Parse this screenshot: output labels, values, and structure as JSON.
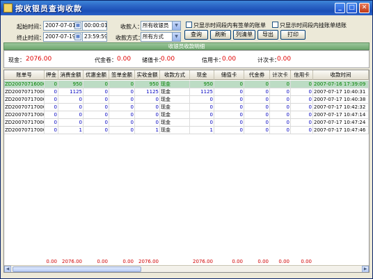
{
  "window": {
    "title": "按收银员查询收款"
  },
  "filters": {
    "start_label": "起始时间：",
    "start_date": "2007-07-01",
    "start_time": "00:00:01",
    "end_label": "终止时间：",
    "end_date": "2007-07-19",
    "end_time": "23:59:59",
    "cashier_label": "收款人：",
    "cashier_value": "所有收银员",
    "method_label": "收款方式：",
    "method_value": "所有方式",
    "chk1_label": "只显示时间段内有签单的账单",
    "chk2_label": "只显示时间段内挂账单结账"
  },
  "buttons": {
    "query": "查询",
    "refresh": "刷新",
    "list": "列清单",
    "export": "导出",
    "print": "打印"
  },
  "section_title": "收银员收款明细",
  "summary": {
    "cash_label": "现金：",
    "cash_value": "2076.00",
    "voucher_label": "代金卷：",
    "voucher_value": "0.00",
    "stored_label": "储值卡：",
    "stored_value": "0.00",
    "credit_label": "信用卡：",
    "credit_value": "0.00",
    "count_label": "计次卡：",
    "count_value": "0.00"
  },
  "table": {
    "columns": [
      "账单号",
      "押金",
      "消费金额",
      "优惠金额",
      "签单金额",
      "实收金额",
      "收款方式",
      "现金",
      "储值卡",
      "代金券",
      "计次卡",
      "信用卡",
      "收款时间"
    ],
    "rows": [
      [
        "ZD200707160001",
        "0",
        "950",
        "0",
        "0",
        "950",
        "现金",
        "950",
        "0",
        "0",
        "0",
        "0",
        "2007-07-16 17:39:09"
      ],
      [
        "ZD200707170001",
        "0",
        "1125",
        "0",
        "0",
        "1125",
        "现金",
        "1125",
        "0",
        "0",
        "0",
        "0",
        "2007-07-17 10:40:31"
      ],
      [
        "ZD200707170002",
        "0",
        "0",
        "0",
        "0",
        "0",
        "现金",
        "0",
        "0",
        "0",
        "0",
        "0",
        "2007-07-17 10:40:38"
      ],
      [
        "ZD200707170003",
        "0",
        "0",
        "0",
        "0",
        "0",
        "现金",
        "0",
        "0",
        "0",
        "0",
        "0",
        "2007-07-17 10:42:32"
      ],
      [
        "ZD200707170004",
        "0",
        "0",
        "0",
        "0",
        "0",
        "现金",
        "0",
        "0",
        "0",
        "0",
        "0",
        "2007-07-17 10:47:14"
      ],
      [
        "ZD200707170005",
        "0",
        "0",
        "0",
        "0",
        "0",
        "现金",
        "0",
        "0",
        "0",
        "0",
        "0",
        "2007-07-17 10:47:24"
      ],
      [
        "ZD200707170006",
        "0",
        "1",
        "0",
        "0",
        "1",
        "现金",
        "1",
        "0",
        "0",
        "0",
        "0",
        "2007-07-17 10:47:46"
      ]
    ],
    "totals": [
      "0.00",
      "2076.00",
      "0.00",
      "0.00",
      "2076.00",
      "2076.00",
      "0.00",
      "0.00",
      "0.00",
      "0.00"
    ]
  },
  "colors": {
    "accent_green": "#008000",
    "value_red": "#e00000",
    "title_blue": "#1b4fb6"
  },
  "icons": {
    "calendar": "calendar-icon",
    "dropdown": "chevron-down-icon"
  }
}
